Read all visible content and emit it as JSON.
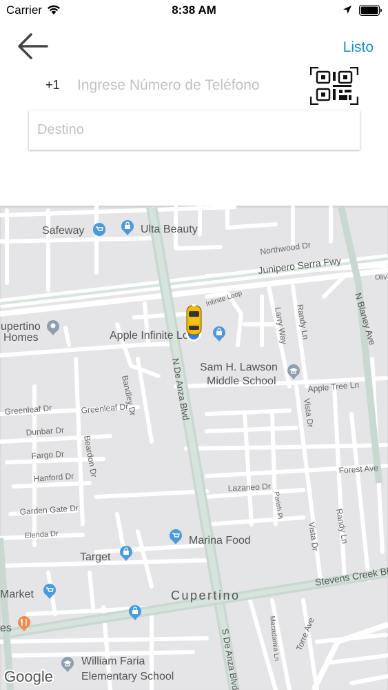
{
  "status_bar": {
    "carrier": "Carrier",
    "time": "8:38 AM"
  },
  "header": {
    "done_label": "Listo"
  },
  "phone": {
    "prefix": "+1",
    "placeholder": "Ingrese Número de Teléfono"
  },
  "destination": {
    "placeholder": "Destino"
  },
  "map": {
    "labels": {
      "safeway": "Safeway",
      "ulta": "Ulta Beauty",
      "northwood": "Northwood Dr",
      "junipero": "Junipero Serra Fwy",
      "oliv": "Oliv",
      "cupertino_homes_1": "upertino",
      "cupertino_homes_2": "Homes",
      "infinite_loop": "Infinite Loop",
      "apple_infinite_loop": "Apple Infinite Loop",
      "larry_way": "Larry Way",
      "randy_ln_top": "Randy Ln",
      "blaney": "N Blaney Ave",
      "sam_lawson_1": "Sam H. Lawson",
      "sam_lawson_2": "Middle School",
      "de_anza_top": "N De Anza Blvd",
      "apple_tree": "Apple Tree Ln",
      "greenleaf_left": "Greenleaf Dr",
      "greenleaf_mid": "Greenleaf Dr",
      "bandley": "Bandley Dr",
      "dunbar": "Dunbar Dr",
      "beardon": "Beardon Dr",
      "vista_dr_top": "Vista Dr",
      "fargo": "Fargo Dr",
      "forest": "Forest Ave",
      "hanford": "Hanford Dr",
      "lazaneo": "Lazaneo Dr",
      "garden_gate": "Garden Gate Dr",
      "parish": "Parish Pl",
      "randy_ln_bottom": "Randy Ln",
      "elenda": "Elenda Dr",
      "vista_dr_bottom": "Vista Dr",
      "marina_food": "Marina Food",
      "target": "Target",
      "stevens_creek": "Stevens Creek Bl",
      "market": "Market",
      "cupertino": "Cupertino",
      "macadamia": "Macadamia Ln",
      "torre": "Torre Ave",
      "de_anza_bottom": "S De Anza Blvd",
      "es": "es",
      "william_faria_1": "William Faria",
      "william_faria_2": "Elementary School",
      "google": "Google"
    }
  },
  "colors": {
    "accent": "#1a8fd6",
    "map_background": "#e5e5e7",
    "road": "#ffffff",
    "major_road": "#c5d6d0",
    "poi_blue": "#4a9ae0",
    "poi_gray": "#8e9eb0",
    "poi_orange": "#f28a4a",
    "car": "#f6b900"
  },
  "icons": [
    "wifi-icon",
    "location-arrow-icon",
    "battery-icon",
    "back-arrow-icon",
    "qr-code-icon",
    "shopping-cart-icon",
    "shopping-bag-icon",
    "graduation-cap-icon",
    "restaurant-icon",
    "taxi-car-icon"
  ]
}
